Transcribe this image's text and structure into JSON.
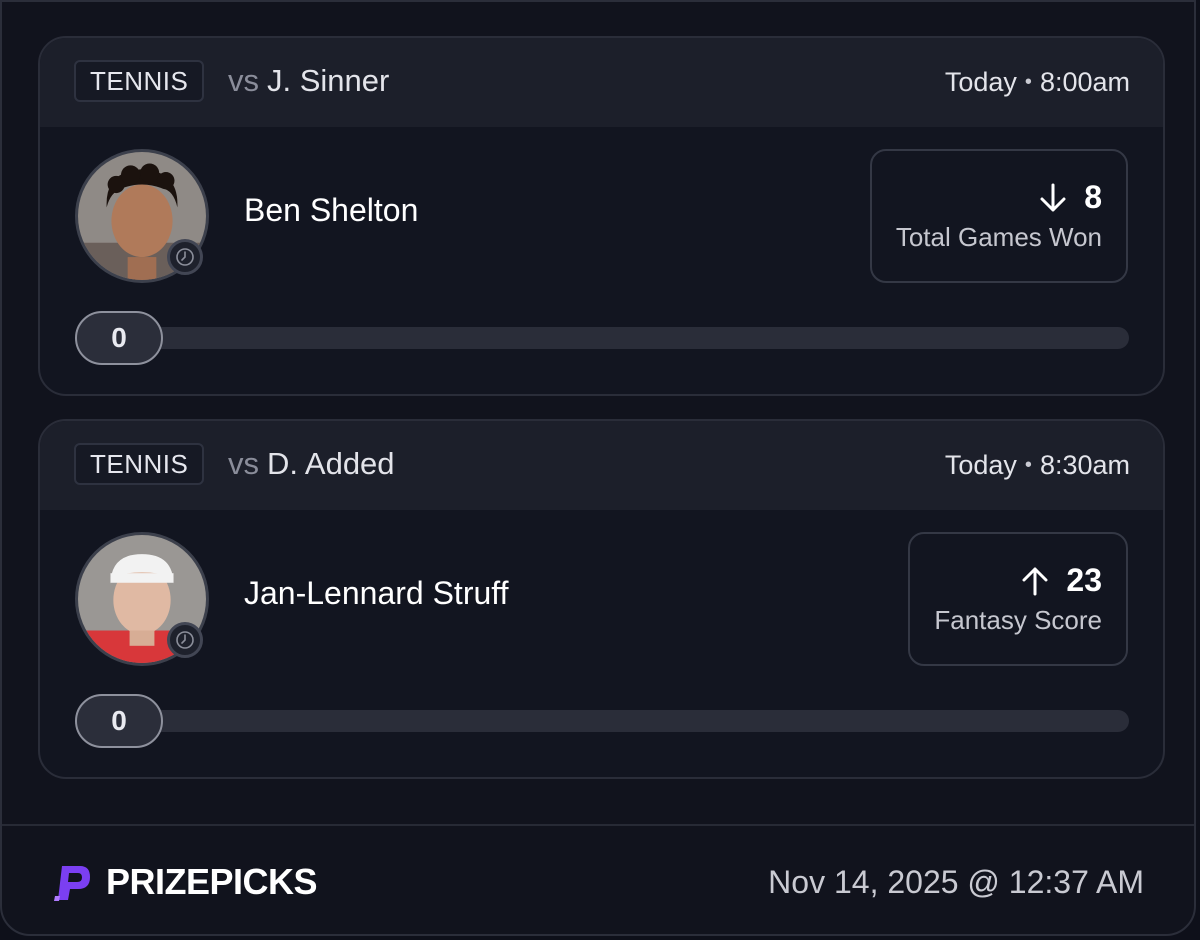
{
  "brand": {
    "name": "PRIZEPICKS",
    "logo_icon": "prizepicks-logo-icon",
    "accent": "#7b3ff2"
  },
  "timestamp": "Nov 14, 2025 @ 12:37 AM",
  "picks": [
    {
      "sport": "TENNIS",
      "vs_word": "vs",
      "opponent": "J. Sinner",
      "day": "Today",
      "time": "8:00am",
      "player": "Ben Shelton",
      "direction": "down",
      "direction_icon": "arrow-down-icon",
      "line": "8",
      "stat": "Total Games Won",
      "progress_value": "0"
    },
    {
      "sport": "TENNIS",
      "vs_word": "vs",
      "opponent": "D. Added",
      "day": "Today",
      "time": "8:30am",
      "player": "Jan-Lennard Struff",
      "direction": "up",
      "direction_icon": "arrow-up-icon",
      "line": "23",
      "stat": "Fantasy Score",
      "progress_value": "0"
    }
  ]
}
